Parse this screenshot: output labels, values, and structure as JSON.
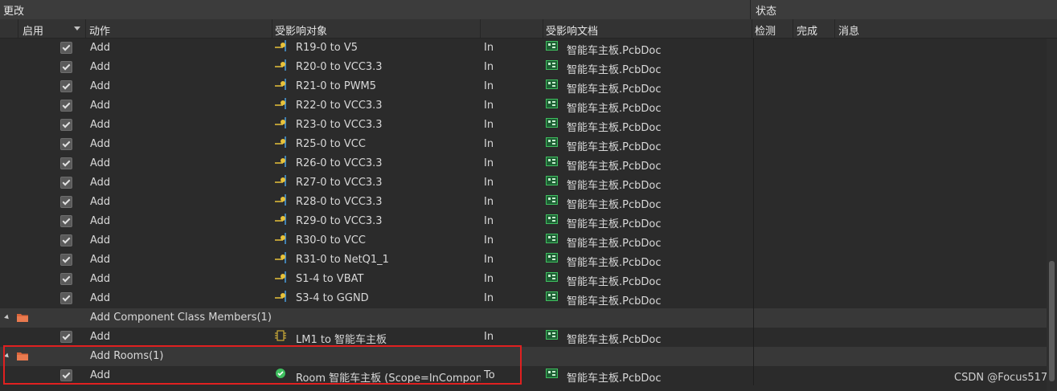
{
  "header": {
    "changes_label": "更改",
    "status_label": "状态",
    "columns": {
      "enable": "启用",
      "action": "动作",
      "affected_object": "受影响对象",
      "affected_document": "受影响文档",
      "check": "检测",
      "done": "完成",
      "message": "消息"
    }
  },
  "rows": [
    {
      "action": "Add",
      "object": "R19-0 to V5",
      "dir": "In",
      "document": "智能车主板.PcbDoc"
    },
    {
      "action": "Add",
      "object": "R20-0 to VCC3.3",
      "dir": "In",
      "document": "智能车主板.PcbDoc"
    },
    {
      "action": "Add",
      "object": "R21-0 to PWM5",
      "dir": "In",
      "document": "智能车主板.PcbDoc"
    },
    {
      "action": "Add",
      "object": "R22-0 to VCC3.3",
      "dir": "In",
      "document": "智能车主板.PcbDoc"
    },
    {
      "action": "Add",
      "object": "R23-0 to VCC3.3",
      "dir": "In",
      "document": "智能车主板.PcbDoc"
    },
    {
      "action": "Add",
      "object": "R25-0 to VCC",
      "dir": "In",
      "document": "智能车主板.PcbDoc"
    },
    {
      "action": "Add",
      "object": "R26-0 to VCC3.3",
      "dir": "In",
      "document": "智能车主板.PcbDoc"
    },
    {
      "action": "Add",
      "object": "R27-0 to VCC3.3",
      "dir": "In",
      "document": "智能车主板.PcbDoc"
    },
    {
      "action": "Add",
      "object": "R28-0 to VCC3.3",
      "dir": "In",
      "document": "智能车主板.PcbDoc"
    },
    {
      "action": "Add",
      "object": "R29-0 to VCC3.3",
      "dir": "In",
      "document": "智能车主板.PcbDoc"
    },
    {
      "action": "Add",
      "object": "R30-0 to VCC",
      "dir": "In",
      "document": "智能车主板.PcbDoc"
    },
    {
      "action": "Add",
      "object": "R31-0 to NetQ1_1",
      "dir": "In",
      "document": "智能车主板.PcbDoc"
    },
    {
      "action": "Add",
      "object": "S1-4 to VBAT",
      "dir": "In",
      "document": "智能车主板.PcbDoc"
    },
    {
      "action": "Add",
      "object": "S3-4 to GGND",
      "dir": "In",
      "document": "智能车主板.PcbDoc"
    }
  ],
  "group_class_members": {
    "label": "Add Component Class Members(1)",
    "row": {
      "action": "Add",
      "object": "LM1 to 智能车主板",
      "dir": "In",
      "document": "智能车主板.PcbDoc"
    }
  },
  "group_rooms": {
    "label": "Add Rooms(1)",
    "row": {
      "action": "Add",
      "object": "Room 智能车主板 (Scope=InCompon",
      "dir": "To",
      "document": "智能车主板.PcbDoc"
    }
  },
  "icons": {
    "net": "net-connection-icon",
    "pcb": "pcb-document-icon",
    "folder": "folder-icon",
    "component": "component-icon",
    "room": "room-check-icon"
  },
  "colors": {
    "highlight_box": "#e02020",
    "pcb_green": "#3fbf5f",
    "folder_orange": "#d9653b",
    "net_yellow": "#e8c23a"
  },
  "watermark": "CSDN @Focus517"
}
